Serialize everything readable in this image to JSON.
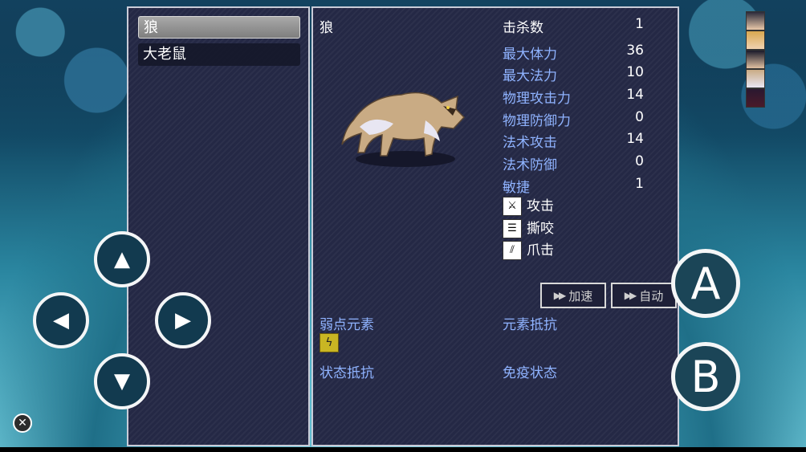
{
  "enemy_list": {
    "items": [
      {
        "label": "狼",
        "selected": true
      },
      {
        "label": "大老鼠",
        "selected": false
      }
    ]
  },
  "detail": {
    "name": "狼",
    "stats": [
      {
        "label": "击杀数",
        "value": "1",
        "white": true
      },
      {
        "label": "最大体力",
        "value": "36"
      },
      {
        "label": "最大法力",
        "value": "10"
      },
      {
        "label": "物理攻击力",
        "value": "14"
      },
      {
        "label": "物理防御力",
        "value": "0"
      },
      {
        "label": "法术攻击",
        "value": "14"
      },
      {
        "label": "法术防御",
        "value": "0"
      },
      {
        "label": "敏捷",
        "value": "1"
      }
    ],
    "skills": [
      {
        "label": "攻击",
        "icon": "sword-icon"
      },
      {
        "label": "撕咬",
        "icon": "bite-icon"
      },
      {
        "label": "爪击",
        "icon": "claw-icon"
      }
    ],
    "sections": {
      "weak": "弱点元素",
      "resist": "元素抵抗",
      "state_resist": "状态抵抗",
      "immune": "免疫状态"
    },
    "weak_element_icon": "thunder-icon"
  },
  "controls": {
    "speed_label": "加速",
    "auto_label": "自动",
    "a_label": "A",
    "b_label": "B"
  },
  "colors": {
    "window_bg": "#242845",
    "label_blue": "#8fb3ff",
    "element_icon": "#c9b623"
  }
}
